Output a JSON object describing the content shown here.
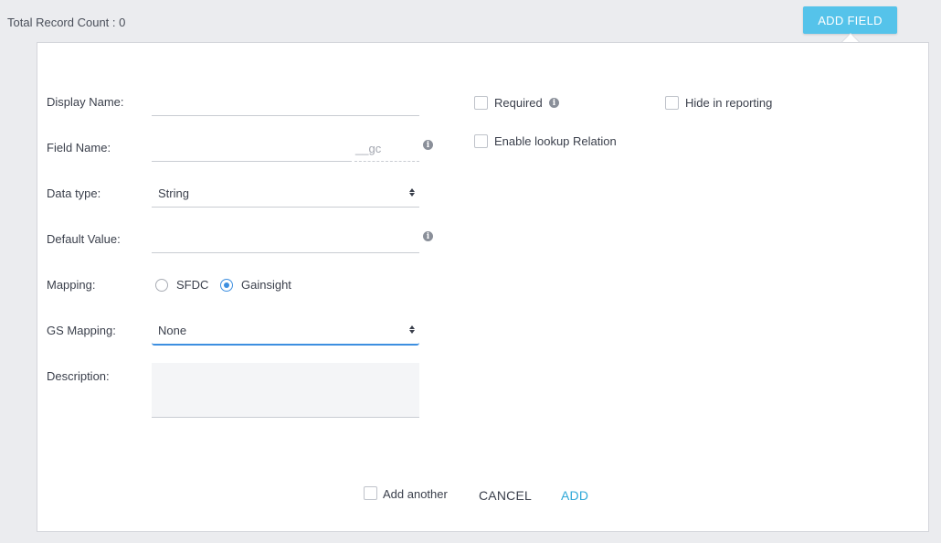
{
  "header": {
    "record_count": "Total Record Count : 0",
    "add_field_label": "ADD FIELD"
  },
  "form": {
    "display_name": {
      "label": "Display Name:",
      "value": ""
    },
    "field_name": {
      "label": "Field Name:",
      "value": "",
      "suffix": "__gc"
    },
    "data_type": {
      "label": "Data type:",
      "selected": "String"
    },
    "default_value": {
      "label": "Default Value:",
      "value": ""
    },
    "mapping": {
      "label": "Mapping:",
      "options": [
        {
          "label": "SFDC",
          "checked": false
        },
        {
          "label": "Gainsight",
          "checked": true
        }
      ]
    },
    "gs_mapping": {
      "label": "GS Mapping:",
      "selected": "None"
    },
    "description": {
      "label": "Description:",
      "value": ""
    }
  },
  "options": {
    "required": {
      "label": "Required",
      "checked": false
    },
    "hide_in_reporting": {
      "label": "Hide in reporting",
      "checked": false
    },
    "enable_lookup": {
      "label": "Enable lookup Relation",
      "checked": false
    }
  },
  "footer": {
    "add_another": {
      "label": "Add another",
      "checked": false
    },
    "cancel_label": "CANCEL",
    "add_label": "ADD"
  },
  "colors": {
    "accent": "#55c3ea",
    "link": "#2fa8d8",
    "radio_active": "#3d8fe0",
    "focus_underline": "#3d8fe0"
  },
  "icons": [
    "info-icon",
    "sort-icon"
  ]
}
